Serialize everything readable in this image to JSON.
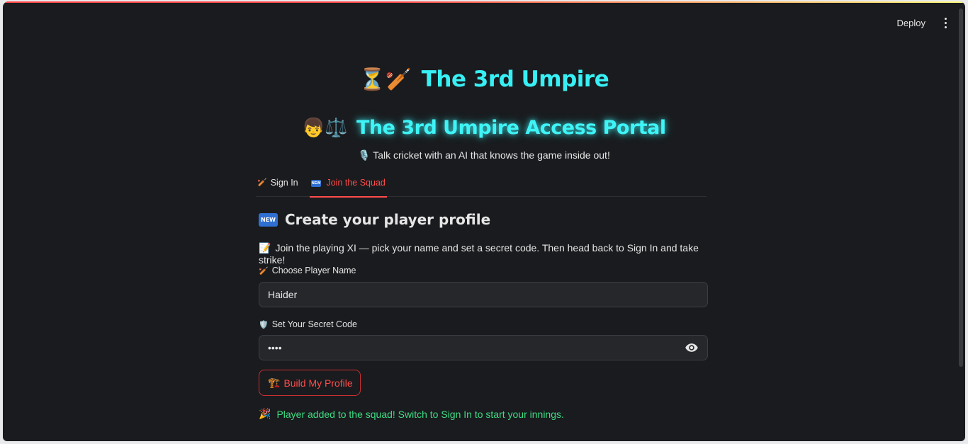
{
  "toolbar": {
    "deploy_label": "Deploy"
  },
  "app": {
    "title": "The 3rd Umpire",
    "title_icons": "⏳🏏",
    "portal_title": "The 3rd Umpire Access Portal",
    "portal_icons": "👦⚖️",
    "tagline_icon": "🎙️",
    "tagline": "Talk cricket with an AI that knows the game inside out!"
  },
  "tabs": [
    {
      "icon": "🏏",
      "label": "Sign In",
      "active": false
    },
    {
      "icon": "new-badge",
      "label": "Join the Squad",
      "active": true
    }
  ],
  "badge_text": "NEW",
  "form": {
    "heading": "Create your player profile",
    "intro_icon": "📝",
    "intro": "Join the playing XI — pick your name and set a secret code. Then head back to Sign In and take strike!",
    "name_label_icon": "🏏",
    "name_label": "Choose Player Name",
    "name_value": "Haider",
    "code_label_icon": "🛡️",
    "code_label": "Set Your Secret Code",
    "code_value": "••••",
    "button_icon": "🏗️",
    "button_label": "Build My Profile",
    "success_icon": "🎉",
    "success": "Player added to the squad! Switch to Sign In to start your innings."
  },
  "colors": {
    "accent": "#ff4b4b",
    "title_cyan": "#37f0f5",
    "success_green": "#3ddc84",
    "background": "#1a1b1e"
  }
}
